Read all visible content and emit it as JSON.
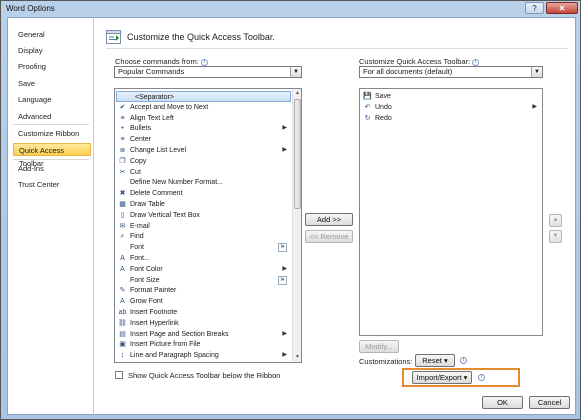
{
  "window": {
    "title": "Word Options",
    "help": "?",
    "close": "✕"
  },
  "nav": {
    "items": [
      {
        "label": "General"
      },
      {
        "label": "Display"
      },
      {
        "label": "Proofing"
      },
      {
        "label": "Save"
      },
      {
        "label": "Language"
      },
      {
        "label": "Advanced"
      },
      {
        "label": "Customize Ribbon"
      },
      {
        "label": "Quick Access Toolbar",
        "selected": true
      },
      {
        "label": "Add-Ins"
      },
      {
        "label": "Trust Center"
      }
    ]
  },
  "header": {
    "text": "Customize the Quick Access Toolbar."
  },
  "left": {
    "label": "Choose commands from:",
    "select_value": "Popular Commands",
    "commands": [
      {
        "label": "<Separator>",
        "icon": "",
        "selected": true
      },
      {
        "label": "Accept and Move to Next",
        "icon": "✔"
      },
      {
        "label": "Align Text Left",
        "icon": "≡"
      },
      {
        "label": "Bullets",
        "icon": "•",
        "sub": "▶"
      },
      {
        "label": "Center",
        "icon": "≡"
      },
      {
        "label": "Change List Level",
        "icon": "≣",
        "sub": "▶"
      },
      {
        "label": "Copy",
        "icon": "❐"
      },
      {
        "label": "Cut",
        "icon": "✂"
      },
      {
        "label": "Define New Number Format...",
        "icon": ""
      },
      {
        "label": "Delete Comment",
        "icon": "✖"
      },
      {
        "label": "Draw Table",
        "icon": "▦"
      },
      {
        "label": "Draw Vertical Text Box",
        "icon": "▯"
      },
      {
        "label": "E-mail",
        "icon": "✉"
      },
      {
        "label": "Find",
        "icon": "⌕"
      },
      {
        "label": "Font",
        "icon": "",
        "sfx": "I▾"
      },
      {
        "label": "Font...",
        "icon": "A"
      },
      {
        "label": "Font Color",
        "icon": "A",
        "sub": "▶"
      },
      {
        "label": "Font Size",
        "icon": "",
        "sfx": "I▾"
      },
      {
        "label": "Format Painter",
        "icon": "✎"
      },
      {
        "label": "Grow Font",
        "icon": "A"
      },
      {
        "label": "Insert Footnote",
        "icon": "ab"
      },
      {
        "label": "Insert Hyperlink",
        "icon": "⛓"
      },
      {
        "label": "Insert Page and Section Breaks",
        "icon": "▤",
        "sub": "▶"
      },
      {
        "label": "Insert Picture from File",
        "icon": "▣"
      },
      {
        "label": "Line and Paragraph Spacing",
        "icon": "↕",
        "sub": "▶"
      }
    ]
  },
  "right": {
    "label": "Customize Quick Access Toolbar:",
    "select_value": "For all documents (default)",
    "items": [
      {
        "label": "Save",
        "icon": "💾"
      },
      {
        "label": "Undo",
        "icon": "↶",
        "sub": "▶"
      },
      {
        "label": "Redo",
        "icon": "↻"
      }
    ]
  },
  "buttons": {
    "add": "Add >>",
    "remove": "<< Remove",
    "modify": "Modify...",
    "customizations": "Customizations:",
    "reset": "Reset ▾",
    "import_export": "Import/Export ▾",
    "ok": "OK",
    "cancel": "Cancel",
    "move_up": "▲",
    "move_down": "▼"
  },
  "checkbox": {
    "label": "Show Quick Access Toolbar below the Ribbon"
  },
  "colors": {
    "highlight": "#e58a2e",
    "selected_nav": "#ffcf52"
  }
}
